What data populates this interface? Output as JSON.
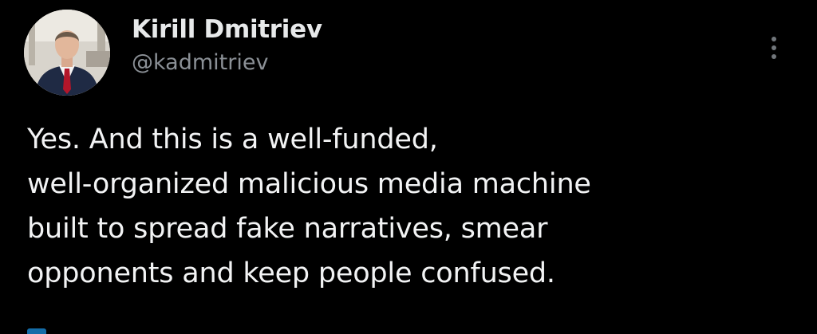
{
  "tweet": {
    "author": {
      "display_name": "Kirill Dmitriev",
      "handle": "@kadmitriev",
      "avatar_icon": "profile-photo"
    },
    "more_icon": "vertical-ellipsis-icon",
    "text": "Yes. And this is a well-funded,\nwell-organized malicious media machine\nbuilt to spread fake narratives, smear\nopponents and keep people confused."
  },
  "colors": {
    "background": "#000000",
    "primary_text": "#e7e9ea",
    "secondary_text": "#8b9096",
    "accent": "#1d9bf0"
  }
}
